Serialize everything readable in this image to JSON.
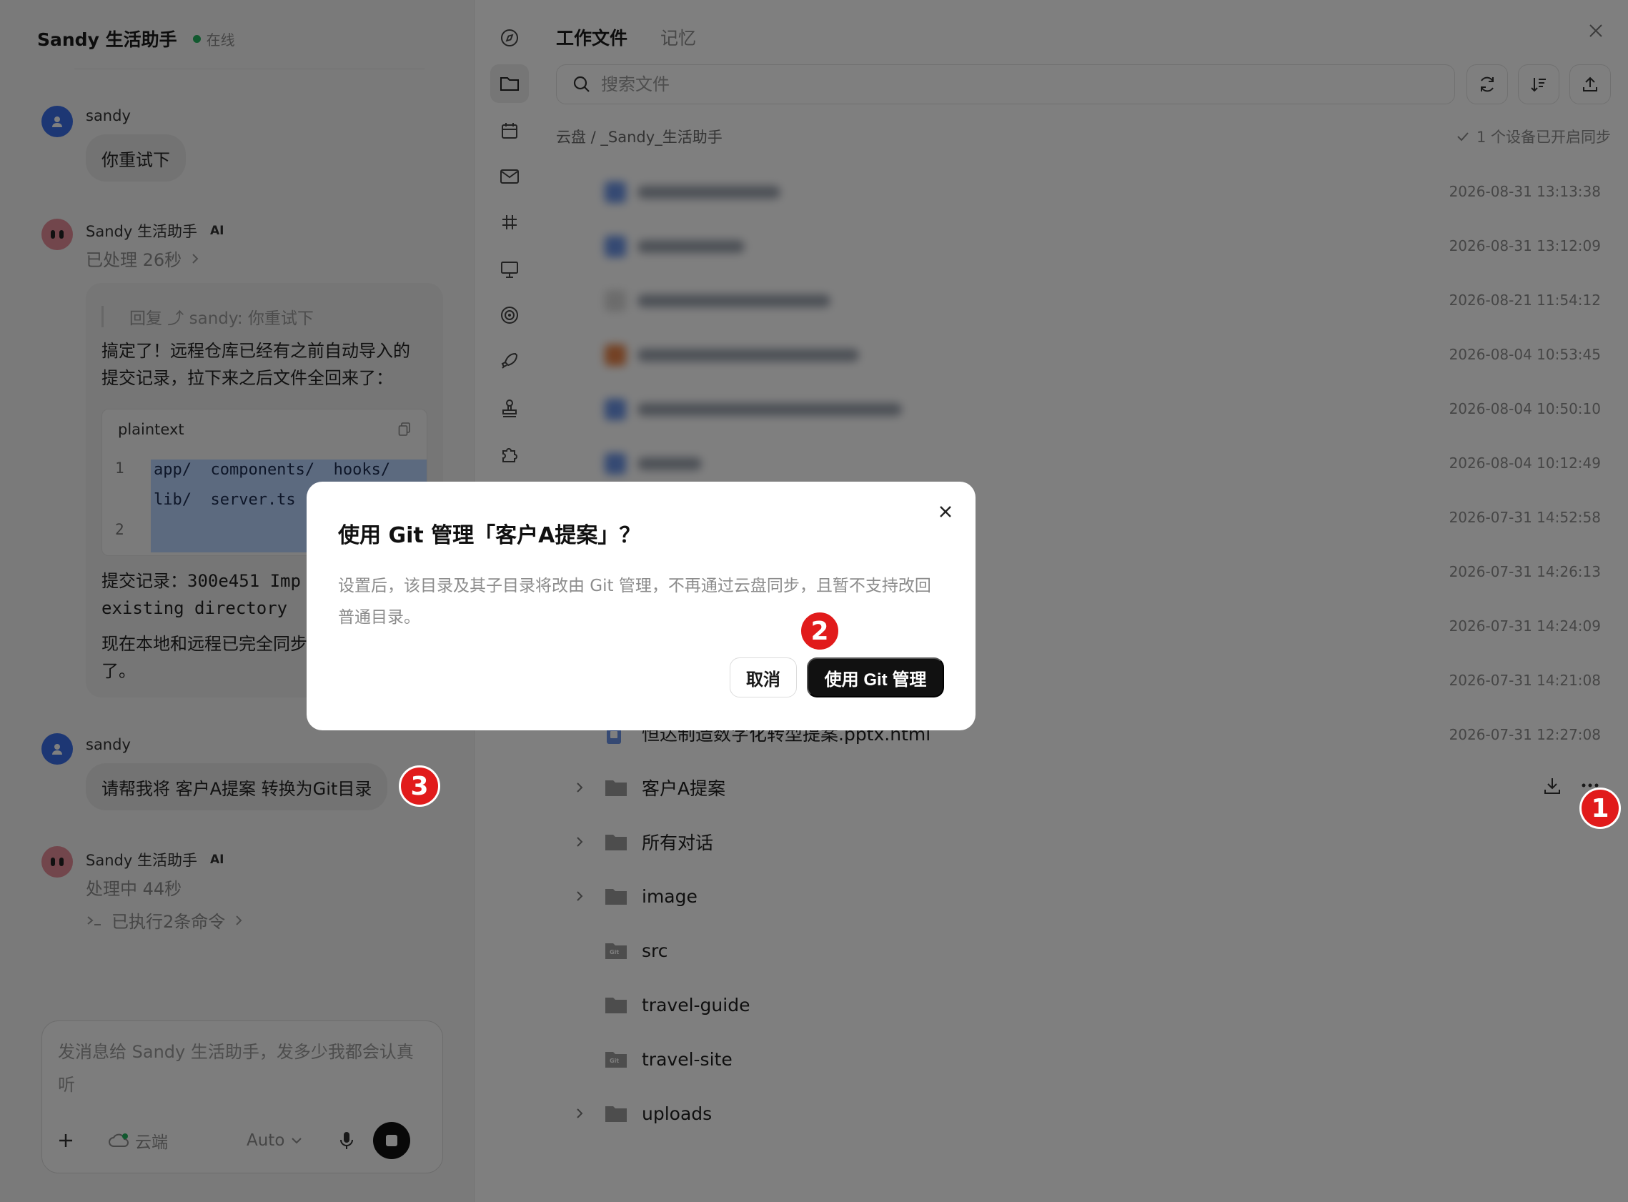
{
  "chat": {
    "title": "Sandy 生活助手",
    "status": "在线",
    "messages": {
      "m1": {
        "sender": "sandy",
        "text": "你重试下"
      },
      "m2": {
        "sender": "Sandy 生活助手",
        "ai_tag": "AI",
        "status": "已处理 26秒",
        "quote": "回复 ⤴ sandy:  你重试下",
        "text_1": "搞定了！远程仓库已经有之前自动导入的\n提交记录，拉下来之后文件全回来了：",
        "code_lang": "plaintext",
        "code_line_1": "app/  components/  hooks/",
        "code_line_1b": "lib/  server.ts",
        "line_no_1": "1",
        "line_no_2": "2",
        "text_2": "提交记录：300e451 Imp\nexisting directory",
        "text_3": "现在本地和远程已完全同步\n了。"
      },
      "m3": {
        "sender": "sandy",
        "text": "请帮我将 客户A提案 转换为Git目录"
      },
      "m4": {
        "sender": "Sandy 生活助手",
        "ai_tag": "AI",
        "status": "处理中 44秒",
        "commands": "已执行2条命令"
      }
    },
    "composer": {
      "placeholder": "发消息给 Sandy 生活助手，发多少我都会认真听",
      "cloud_label": "云端",
      "model_label": "Auto"
    }
  },
  "files": {
    "tabs": [
      "工作文件",
      "记忆"
    ],
    "search_placeholder": "搜索文件",
    "breadcrumb": "云盘 / _Sandy_生活助手",
    "sync_status": "1 个设备已开启同步",
    "timestamps": [
      "2026-08-31 13:13:38",
      "2026-08-31 13:12:09",
      "2026-08-21 11:54:12",
      "2026-08-04 10:53:45",
      "2026-08-04 10:50:10",
      "2026-08-04 10:12:49",
      "2026-07-31 14:52:58",
      "2026-07-31 14:26:13",
      "2026-07-31 14:24:09",
      "2026-07-31 14:21:08",
      "2026-07-31 12:27:08"
    ],
    "partial_file": "恒达制造数字化转型提案.pptx.html",
    "folders": {
      "f1": "客户A提案",
      "f2": "所有对话",
      "f3": "image",
      "f4": "src",
      "f5": "travel-guide",
      "f6": "travel-site",
      "f7": "uploads"
    },
    "git_badge": "Git"
  },
  "modal": {
    "title": "使用 Git 管理「客户A提案」？",
    "body": "设置后，该目录及其子目录将改由 Git 管理，不再通过云盘同步，且暂不支持改回普通目录。",
    "cancel": "取消",
    "confirm": "使用 Git 管理"
  },
  "markers": [
    "1",
    "2",
    "3"
  ],
  "colors": {
    "accent_dark": "#111111",
    "online_green": "#22b35e",
    "user_avatar": "#3b6ee8",
    "bot_avatar": "#e58c98",
    "marker_red": "#e11b1b"
  }
}
